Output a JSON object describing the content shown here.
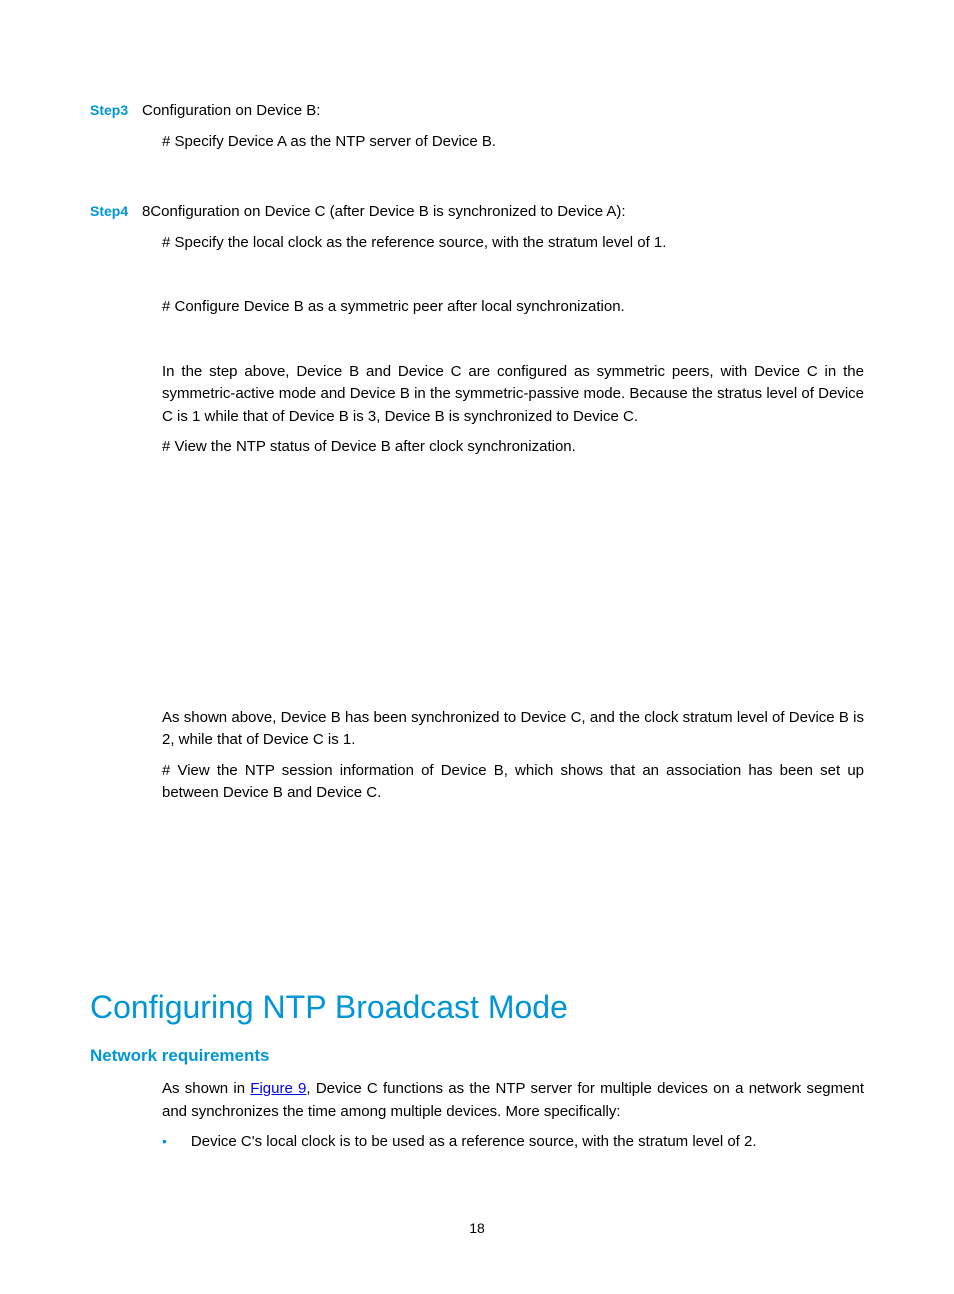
{
  "step3": {
    "label": "Step3",
    "title": "Configuration on Device B:",
    "text1": "# Specify Device A as the NTP server of Device B."
  },
  "step4": {
    "label": "Step4",
    "title": "8Configuration on Device C (after Device B is synchronized to Device A):",
    "text1": "# Specify the local clock as the reference source, with the stratum level of 1.",
    "text2": "# Configure Device B as a symmetric peer after local synchronization.",
    "text3": "In the step above, Device B and Device C are configured as symmetric peers, with Device C in the symmetric-active mode and Device B in the symmetric-passive mode. Because the stratus level of Device C is 1 while that of Device B is 3, Device B is synchronized to Device C.",
    "text4": "# View the NTP status of Device B after clock synchronization.",
    "text5": "As shown above, Device B has been synchronized to Device C, and the clock stratum level of Device B is 2, while that of Device C is 1.",
    "text6": "# View the NTP session information of Device B, which shows that an association has been set up between Device B and Device C."
  },
  "section": {
    "heading": "Configuring NTP Broadcast Mode",
    "subheading": "Network requirements",
    "intro_prefix": "As shown in ",
    "intro_link": "Figure 9",
    "intro_suffix": ", Device C functions as the NTP server for multiple devices on a network segment and synchronizes the time among multiple devices. More specifically:",
    "bullet1": "Device C's local clock is to be used as a reference source, with the stratum level of 2."
  },
  "page_number": "18"
}
